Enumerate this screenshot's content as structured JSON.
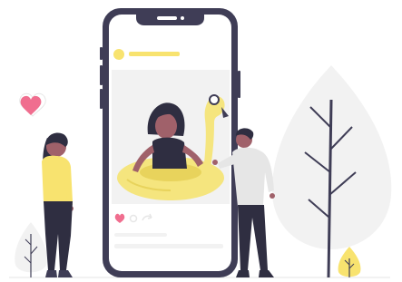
{
  "illustration": {
    "subject": "social-media-post-phone",
    "post": {
      "liked": true,
      "caption_lines": 2
    },
    "colors": {
      "accent_yellow": "#f8e36f",
      "float_yellow": "#f5e57e",
      "heart_pink": "#f06e8f",
      "phone_frame": "#3f3d56",
      "skin": "#a0616a",
      "hair": "#2f2e41",
      "background_shape": "#f2f2f2",
      "screen_bg": "#ffffff",
      "photo_bg": "#f2f2f2",
      "man_shirt": "#e6e6e6",
      "woman_top": "#f8e36f"
    },
    "icons": [
      "heart-icon",
      "comment-icon",
      "share-icon",
      "avatar"
    ]
  }
}
